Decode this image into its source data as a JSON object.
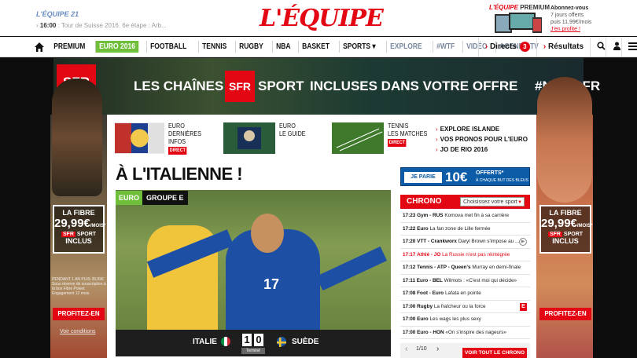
{
  "header": {
    "logo": "L'ÉQUIPE",
    "l21": "L'ÉQUIPE 21",
    "live_time": "16:00",
    "live_text": "Tour de Suisse 2016. 6e étape : Arb...",
    "premium_logo": "L'ÉQUIPE",
    "premium_word": "PREMIUM",
    "abo_title": "Abonnez-vous",
    "abo_line1": "7 jours offerts",
    "abo_line2": "puis 11,99€/mois",
    "abo_link": "J'en profite !"
  },
  "nav": {
    "items": [
      "PREMIUM",
      "EURO 2016",
      "FOOTBALL",
      "TENNIS",
      "RUGBY",
      "NBA",
      "BASKET",
      "SPORTS ▾",
      "EXPLORE",
      "#WTF",
      "VIDÉO",
      "AGENDA TV"
    ],
    "directs": "Directs",
    "directs_count": "3",
    "resultats": "Résultats"
  },
  "banner": {
    "sfr": "SFR",
    "text1": "LES CHAÎNES",
    "sfr2": "SFR",
    "sport": "SPORT",
    "text2": "INCLUSES DANS VOTRE OFFRE",
    "hashtag": "#NEWSFR"
  },
  "promo": {
    "fibre": "LA FIBRE",
    "price": "29,99€",
    "permois": "/MOIS*",
    "sfr": "SFR",
    "sport": "SPORT",
    "inclus": "INCLUS",
    "note": "PENDANT 1 AN PUIS 39,99€ Sous réserve de souscription à la box Fibre Power. Engagement 12 mois.",
    "cta": "PROFITEZ-EN",
    "conditions": "Voir conditions"
  },
  "mini_nav": [
    {
      "line1": "EURO",
      "line2": "DERNIÈRES INFOS",
      "badge": "DIRECT"
    },
    {
      "line1": "EURO",
      "line2": "LE GUIDE",
      "badge": ""
    },
    {
      "line1": "TENNIS",
      "line2": "LES MATCHES",
      "badge": "DIRECT"
    }
  ],
  "links": [
    "EXPLORE ISLANDE",
    "VOS PRONOS POUR L'EURO",
    "JO DE RIO 2016"
  ],
  "headline": "À L'ITALIENNE !",
  "jeparie": {
    "btn": "JE PARIE",
    "amount": "10€",
    "offered": "OFFERTS*",
    "cond": "À CHAQUE BUT DES BLEUS"
  },
  "tag": {
    "cat": "EURO",
    "group": "GROUPE E"
  },
  "match": {
    "team1": "ITALIE",
    "score1": "1",
    "score2": "0",
    "team2": "SUÈDE",
    "status": "Terminé",
    "jersey": "17"
  },
  "chrono": {
    "title": "CHRONO",
    "select": "Choisissez votre sport",
    "rows": [
      {
        "time": "17:23",
        "sport": "Gym - RUS",
        "text": "Komova met fin à sa carrière",
        "red": false
      },
      {
        "time": "17:22",
        "sport": "Euro",
        "text": "La fan zone de Lille fermée",
        "red": false
      },
      {
        "time": "17:20",
        "sport": "VTT - Crankworx",
        "text": "Daryl Brown s'impose au ...",
        "red": false
      },
      {
        "time": "17:17",
        "sport": "Athlé - JO",
        "text": "La Russie n'est pas réintégrée",
        "red": true
      },
      {
        "time": "17:12",
        "sport": "Tennis - ATP - Queen's",
        "text": "Murray en demi-finale",
        "red": false
      },
      {
        "time": "17:11",
        "sport": "Euro - BEL",
        "text": "Wilmots : «C'est moi qui décide»",
        "red": false
      },
      {
        "time": "17:08",
        "sport": "Foot - Euro",
        "text": "Lafata en pointe",
        "red": false
      },
      {
        "time": "17:00",
        "sport": "Rugby",
        "text": "La fraîcheur ou la force",
        "red": false
      },
      {
        "time": "17:00",
        "sport": "Euro",
        "text": "Les wags les plus sexy",
        "red": false
      },
      {
        "time": "17:00",
        "sport": "Euro - HON",
        "text": "«On s'inspire des nageurs»",
        "red": false
      }
    ],
    "pager": "1/10",
    "all": "VOIR TOUT LE CHRONO"
  },
  "colors": {
    "brand_red": "#e30613",
    "euro_green": "#6fbf3a",
    "pari_blue": "#0c5ca8"
  }
}
